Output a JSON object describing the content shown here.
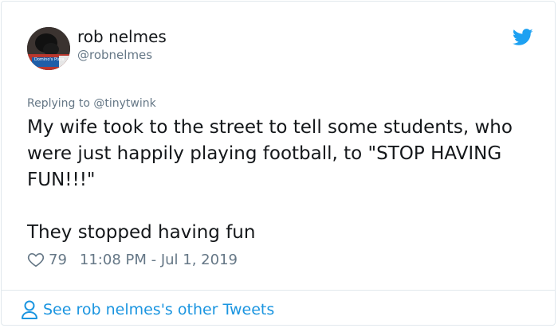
{
  "author": {
    "display_name": "rob nelmes",
    "handle": "@robnelmes",
    "avatar_caption": "Domino's Pizza"
  },
  "reply": {
    "prefix": "Replying to ",
    "mention": "@tinytwink"
  },
  "tweet": {
    "text": "My wife took to the street to tell some students, who were just happily playing football, to \"STOP HAVING FUN!!!\"\n\nThey stopped having fun"
  },
  "meta": {
    "like_count": "79",
    "timestamp": "11:08 PM - Jul 1, 2019"
  },
  "footer": {
    "link_label": "See rob nelmes's other Tweets"
  },
  "icons": {
    "brand": "twitter-bird-icon",
    "like": "heart-icon",
    "profile": "person-icon"
  },
  "colors": {
    "brand_blue": "#1da1f2",
    "link_blue": "#1b95e0",
    "muted_gray": "#657786",
    "text": "#14171a",
    "border": "#e1e8ed"
  }
}
